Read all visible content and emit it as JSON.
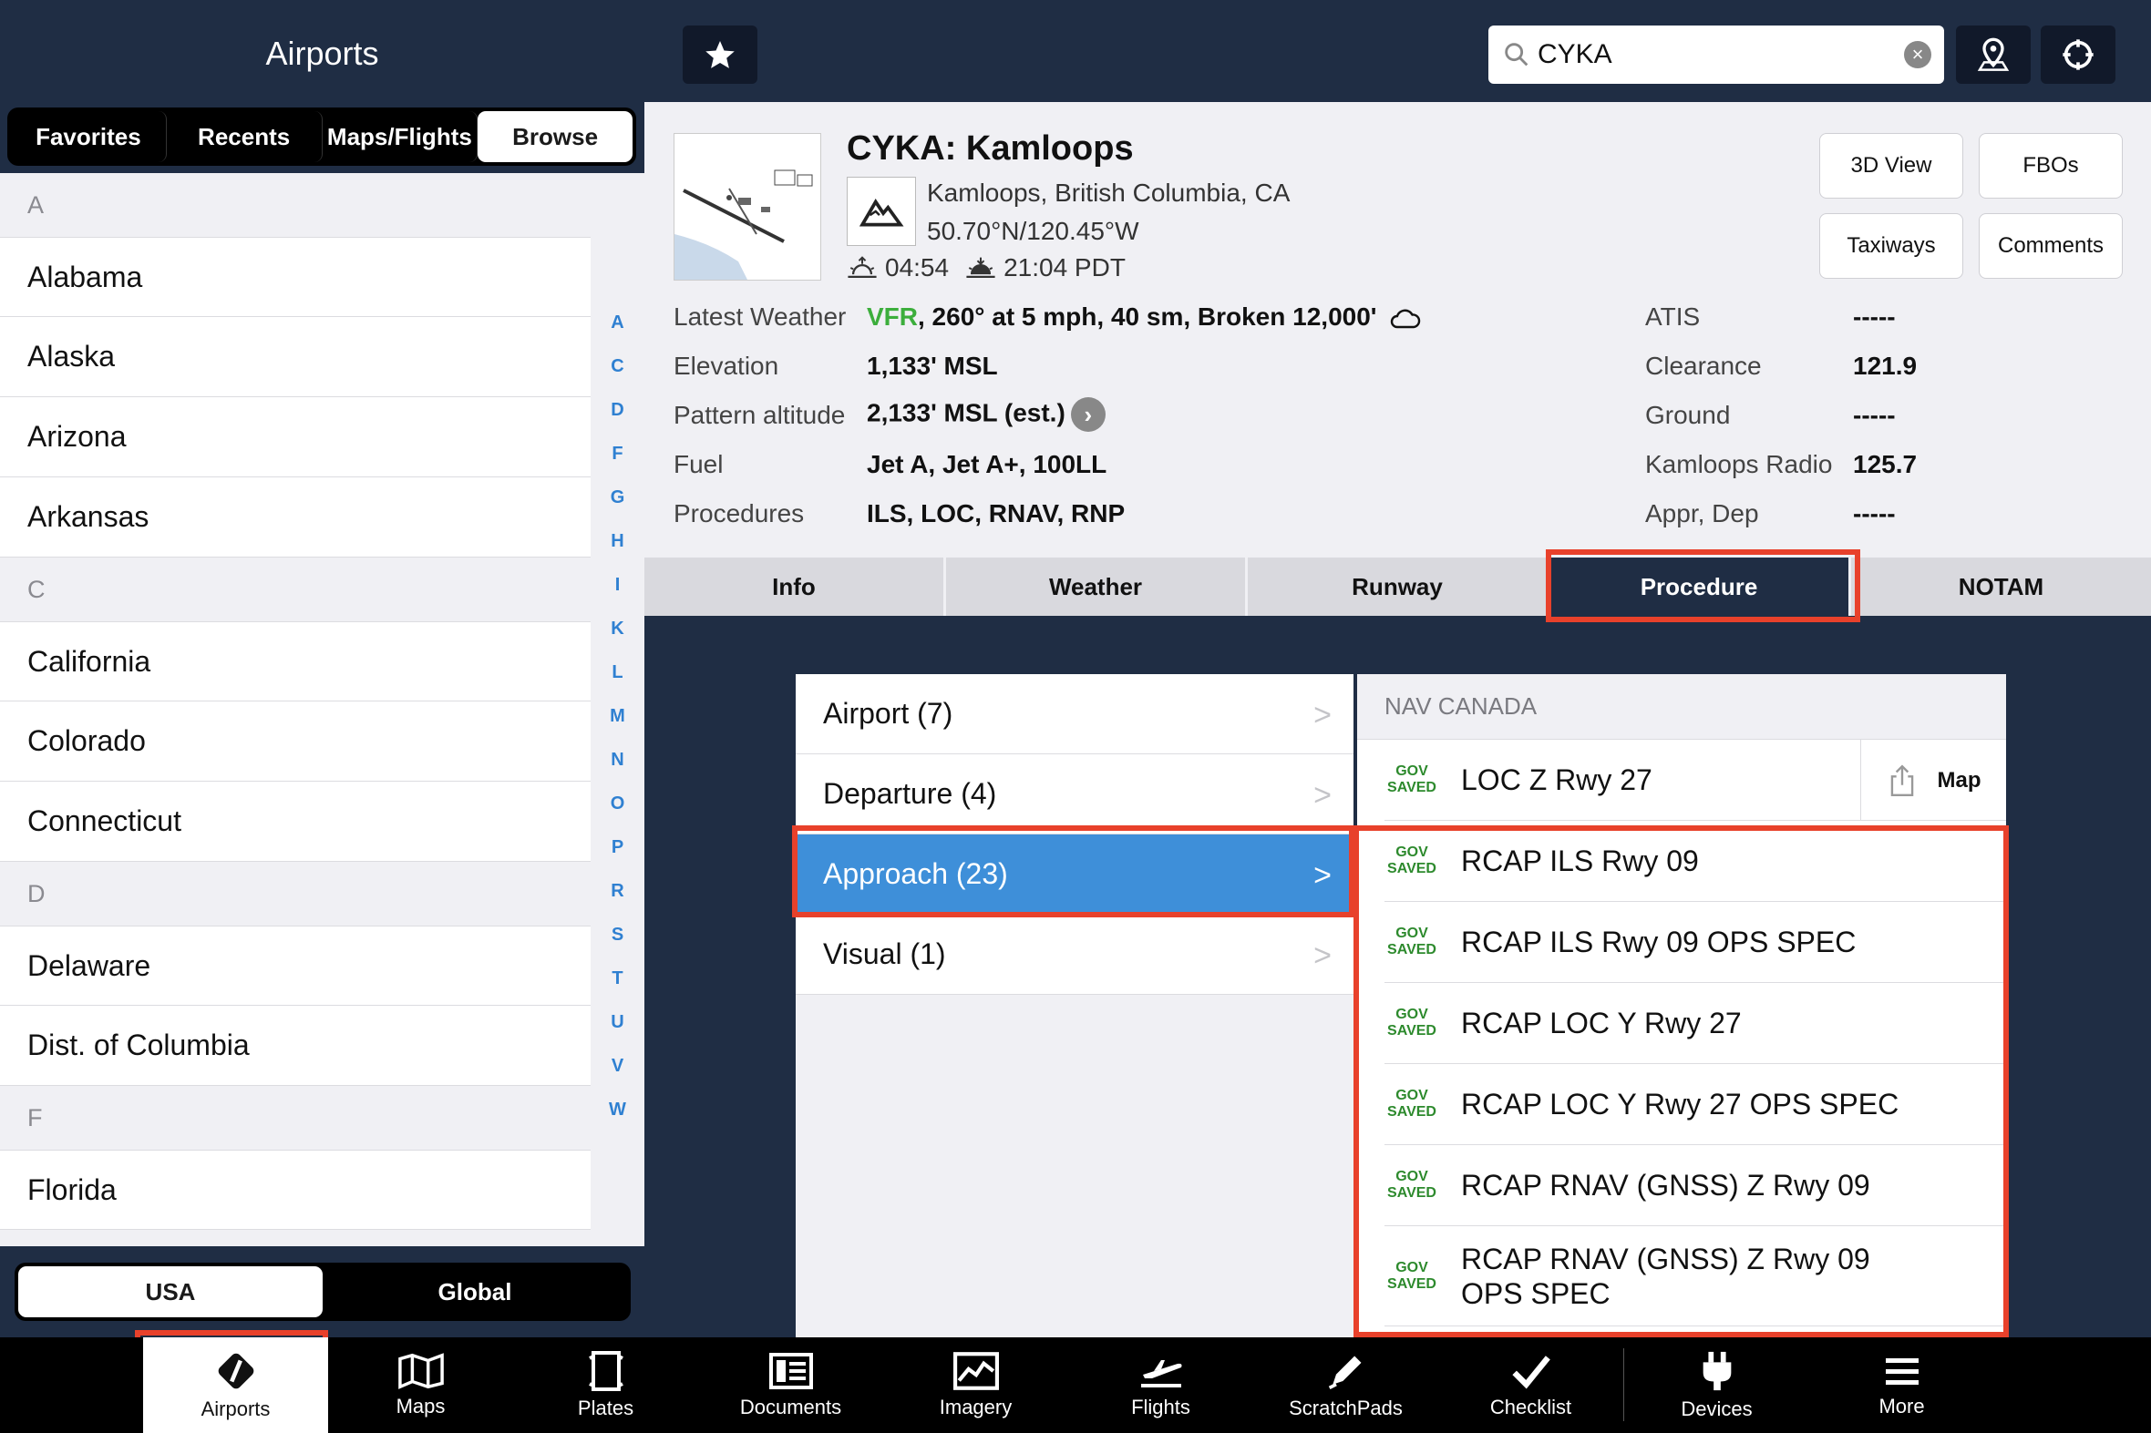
{
  "sidebar": {
    "title": "Airports",
    "tabs": [
      "Favorites",
      "Recents",
      "Maps/Flights",
      "Browse"
    ],
    "active_tab": "Browse",
    "sections": [
      {
        "letter": "A",
        "states": [
          "Alabama",
          "Alaska",
          "Arizona",
          "Arkansas"
        ]
      },
      {
        "letter": "C",
        "states": [
          "California",
          "Colorado",
          "Connecticut"
        ]
      },
      {
        "letter": "D",
        "states": [
          "Delaware",
          "Dist. of Columbia"
        ]
      },
      {
        "letter": "F",
        "states": [
          "Florida"
        ]
      }
    ],
    "index_letters": [
      "A",
      "C",
      "D",
      "F",
      "G",
      "H",
      "I",
      "K",
      "L",
      "M",
      "N",
      "O",
      "P",
      "R",
      "S",
      "T",
      "U",
      "V",
      "W"
    ],
    "region_toggle": [
      "USA",
      "Global"
    ],
    "active_region": "USA"
  },
  "search": {
    "value": "CYKA"
  },
  "airport": {
    "title": "CYKA: Kamloops",
    "location": "Kamloops, British Columbia, CA",
    "coords": "50.70°N/120.45°W",
    "sunrise": "04:54",
    "sunset": "21:04 PDT",
    "buttons": [
      "3D View",
      "FBOs",
      "Taxiways",
      "Comments"
    ],
    "info": {
      "weather_label": "Latest Weather",
      "weather_category": "VFR",
      "weather_text": ", 260° at 5 mph, 40 sm, Broken 12,000'",
      "elevation_label": "Elevation",
      "elevation": "1,133' MSL",
      "pattern_label": "Pattern altitude",
      "pattern": "2,133' MSL (est.)",
      "fuel_label": "Fuel",
      "fuel": "Jet A, Jet A+, 100LL",
      "procedures_label": "Procedures",
      "procedures": "ILS, LOC, RNAV, RNP"
    },
    "freqs": [
      {
        "label": "ATIS",
        "value": "-----"
      },
      {
        "label": "Clearance",
        "value": "121.9"
      },
      {
        "label": "Ground",
        "value": "-----"
      },
      {
        "label": "Kamloops Radio",
        "value": "125.7"
      },
      {
        "label": "Appr, Dep",
        "value": "-----"
      }
    ]
  },
  "tabs": [
    "Info",
    "Weather",
    "Runway",
    "Procedure",
    "NOTAM"
  ],
  "active_tab": "Procedure",
  "categories": [
    {
      "label": "Airport (7)"
    },
    {
      "label": "Departure (4)"
    },
    {
      "label": "Approach (23)"
    },
    {
      "label": "Visual (1)"
    }
  ],
  "active_category": "Approach (23)",
  "procedures": {
    "source": "NAV CANADA",
    "badge_line1": "GOV",
    "badge_line2": "SAVED",
    "map_label": "Map",
    "items": [
      {
        "name": "LOC Z Rwy 27"
      },
      {
        "name": "RCAP ILS Rwy 09"
      },
      {
        "name": "RCAP ILS Rwy 09 OPS SPEC"
      },
      {
        "name": "RCAP LOC Y Rwy 27"
      },
      {
        "name": "RCAP LOC Y Rwy 27 OPS SPEC"
      },
      {
        "name": "RCAP RNAV (GNSS) Z Rwy 09"
      },
      {
        "name": "RCAP RNAV (GNSS) Z Rwy 09 OPS SPEC"
      }
    ]
  },
  "toolbar": [
    "Airports",
    "Maps",
    "Plates",
    "Documents",
    "Imagery",
    "Flights",
    "ScratchPads",
    "Checklist",
    "Devices",
    "More"
  ],
  "active_toolbar": "Airports",
  "colors": {
    "navy": "#1f2d44",
    "highlight": "#e8412b",
    "accent_blue": "#3e8fd9",
    "vfr_green": "#3cae3c"
  }
}
